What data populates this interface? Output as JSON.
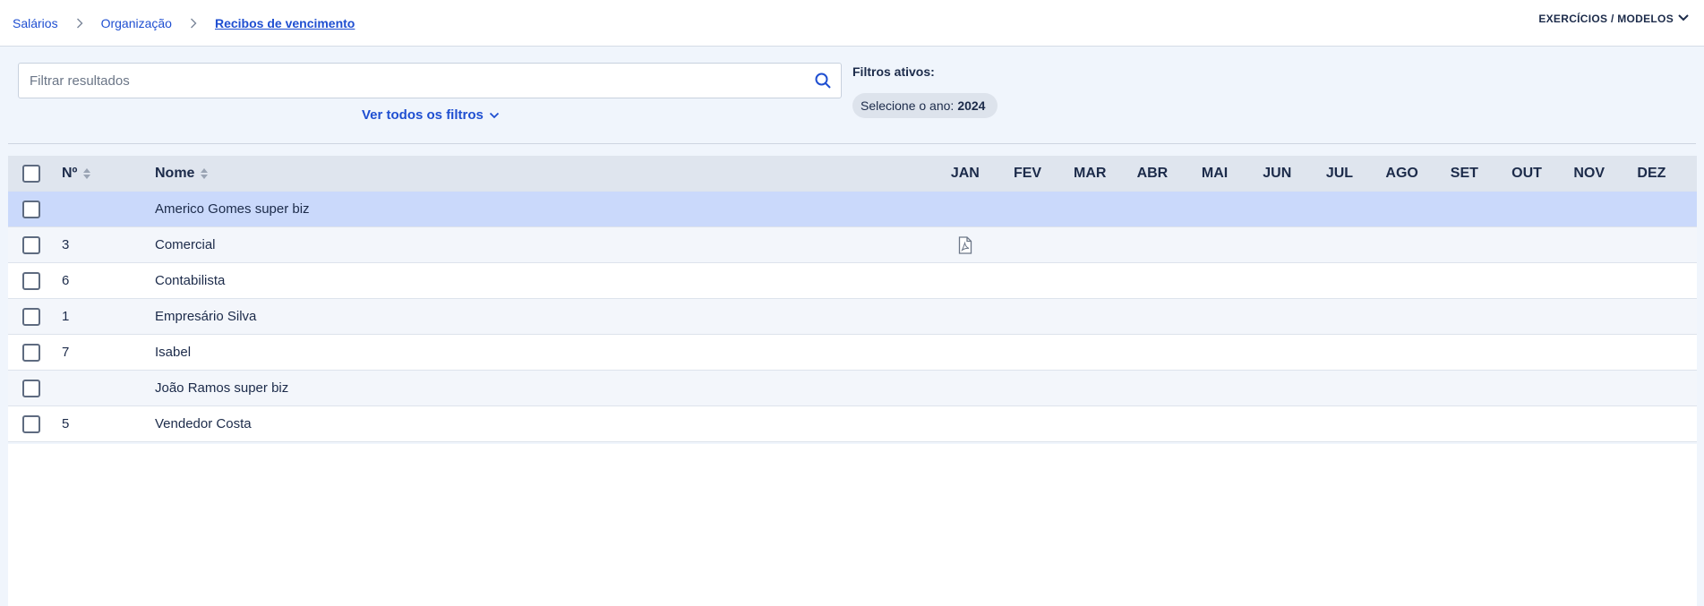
{
  "breadcrumb": {
    "items": [
      "Salários",
      "Organização"
    ],
    "current": "Recibos de vencimento"
  },
  "header": {
    "exercicios_label": "EXERCÍCIOS / MODELOS"
  },
  "search": {
    "placeholder": "Filtrar resultados",
    "value": ""
  },
  "filters": {
    "show_all_label": "Ver todos os filtros",
    "active_title": "Filtros ativos:",
    "chip_label": "Selecione o ano:",
    "chip_value": "2024"
  },
  "table": {
    "columns": {
      "number": "Nº",
      "name": "Nome",
      "months": [
        "JAN",
        "FEV",
        "MAR",
        "ABR",
        "MAI",
        "JUN",
        "JUL",
        "AGO",
        "SET",
        "OUT",
        "NOV",
        "DEZ"
      ]
    },
    "rows": [
      {
        "number": "",
        "name": "Americo Gomes super biz",
        "selected": true,
        "pdf_month": null
      },
      {
        "number": "3",
        "name": "Comercial",
        "selected": false,
        "pdf_month": "JAN"
      },
      {
        "number": "6",
        "name": "Contabilista",
        "selected": false,
        "pdf_month": null
      },
      {
        "number": "1",
        "name": "Empresário Silva",
        "selected": false,
        "pdf_month": null
      },
      {
        "number": "7",
        "name": "Isabel",
        "selected": false,
        "pdf_month": null
      },
      {
        "number": "",
        "name": "João Ramos super biz",
        "selected": false,
        "pdf_month": null
      },
      {
        "number": "5",
        "name": "Vendedor Costa",
        "selected": false,
        "pdf_month": null
      }
    ]
  },
  "colors": {
    "accent": "#1f4fd1",
    "selected_row": "#cad9fb",
    "header_bg": "#dfe5ee"
  }
}
